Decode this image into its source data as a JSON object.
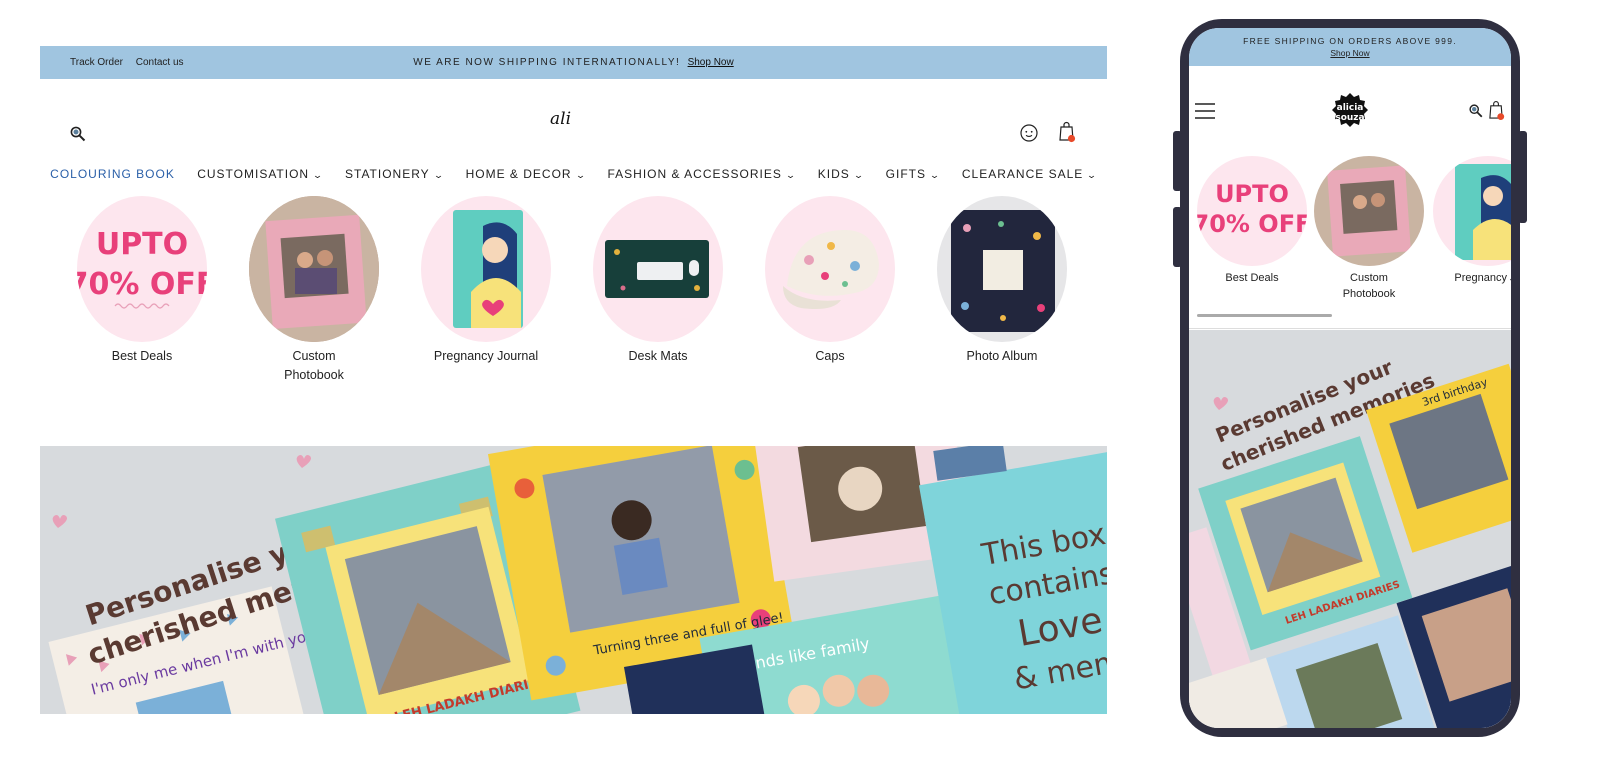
{
  "desktop": {
    "topbar": {
      "track_order": "Track Order",
      "contact_us": "Contact us",
      "announcement": "WE ARE NOW SHIPPING INTERNATIONALLY!",
      "shop_now": "Shop Now"
    },
    "header": {
      "logo_text": "ali"
    },
    "nav": [
      {
        "label": "COLOURING BOOK",
        "dropdown": false,
        "active": true
      },
      {
        "label": "CUSTOMISATION",
        "dropdown": true
      },
      {
        "label": "STATIONERY",
        "dropdown": true
      },
      {
        "label": "HOME & DECOR",
        "dropdown": true
      },
      {
        "label": "FASHION & ACCESSORIES",
        "dropdown": true
      },
      {
        "label": "KIDS",
        "dropdown": true
      },
      {
        "label": "GIFTS",
        "dropdown": true
      },
      {
        "label": "CLEARANCE SALE",
        "dropdown": true
      }
    ],
    "categories": [
      {
        "label": "Best Deals",
        "promo_line1": "UPTO",
        "promo_line2": "70% OFF"
      },
      {
        "label": "Custom Photobook"
      },
      {
        "label": "Pregnancy Journal"
      },
      {
        "label": "Desk Mats"
      },
      {
        "label": "Caps"
      },
      {
        "label": "Photo Album"
      }
    ],
    "hero": {
      "headline_line1": "Personalise your",
      "headline_line2": "cherished memories",
      "book1_caption": "I'm only me when I'm with you!",
      "book2_caption": "LEH LADAKH DIARIES",
      "book3_caption": "Turning three and full of glee!",
      "book4_caption": "Friends like family",
      "book5_line1": "This box",
      "book5_line2": "contains",
      "book5_line3": "Love",
      "book5_line4": "& memo"
    }
  },
  "phone": {
    "topbar": {
      "announcement": "FREE SHIPPING ON ORDERS ABOVE 999.",
      "shop_now": "Shop Now"
    },
    "header": {
      "logo_line1": "alicia",
      "logo_line2": "souza"
    },
    "categories": [
      {
        "label": "Best Deals",
        "promo_line1": "UPTO",
        "promo_line2": "70% OFF"
      },
      {
        "label": "Custom Photobook"
      },
      {
        "label": "Pregnancy Jo"
      }
    ],
    "hero": {
      "headline_line1": "Personalise your",
      "headline_line2": "cherished memories",
      "book_caption": "LEH LADAKH DIARIES",
      "birthday": "3rd birthday"
    }
  },
  "colors": {
    "topbar": "#a0c5e0",
    "promo_pink": "#e8407a",
    "nav_active": "#2a5fa8",
    "phone_frame": "#2f2f40",
    "bag_dot": "#e84a2a"
  },
  "icons": [
    "search-icon",
    "account-icon",
    "bag-icon",
    "menu-icon",
    "chevron-down-icon"
  ]
}
